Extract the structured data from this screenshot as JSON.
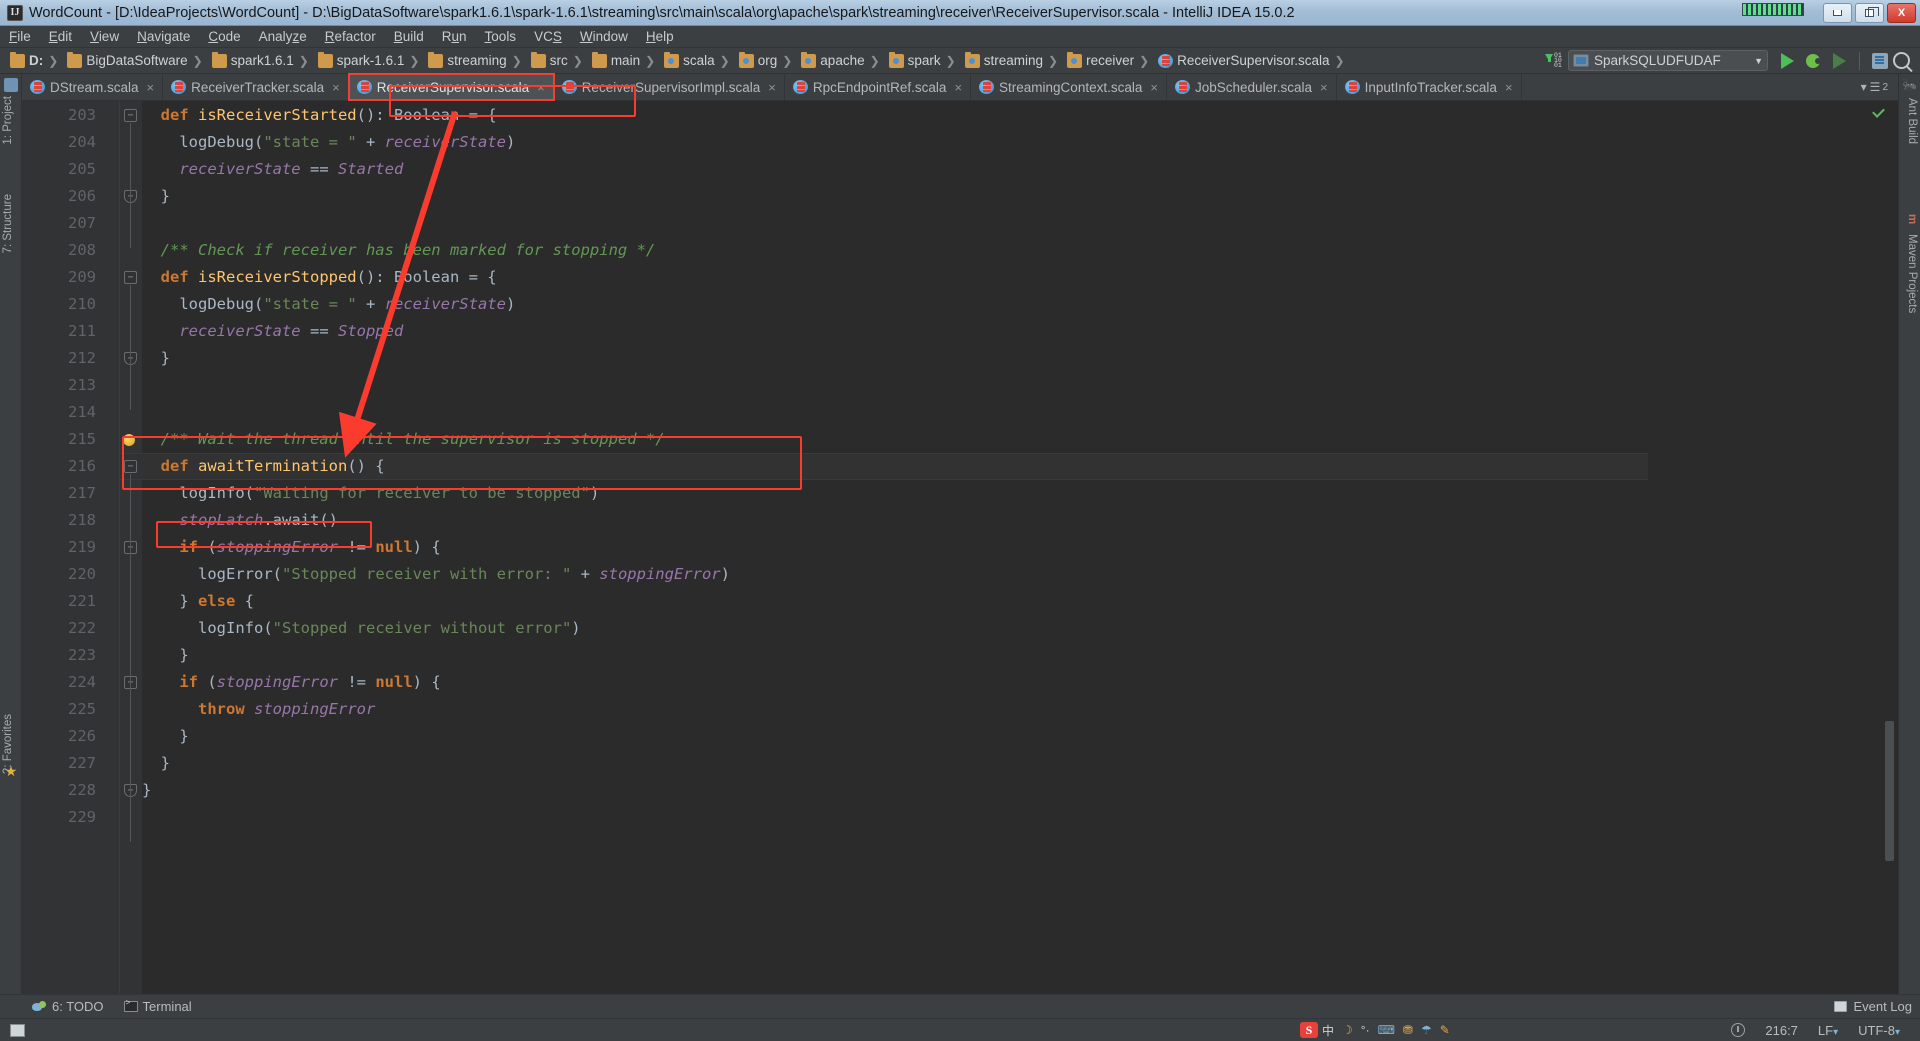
{
  "window": {
    "title": "WordCount - [D:\\IdeaProjects\\WordCount] - D:\\BigDataSoftware\\spark1.6.1\\spark-1.6.1\\streaming\\src\\main\\scala\\org\\apache\\spark\\streaming\\receiver\\ReceiverSupervisor.scala - IntelliJ IDEA 15.0.2",
    "app_icon": "intellij-idea-icon",
    "minimize_label": "",
    "restore_label": "",
    "close_label": "X"
  },
  "menu": {
    "items": [
      {
        "label": "File",
        "mnemonic": "F"
      },
      {
        "label": "Edit",
        "mnemonic": "E"
      },
      {
        "label": "View",
        "mnemonic": "V"
      },
      {
        "label": "Navigate",
        "mnemonic": "N"
      },
      {
        "label": "Code",
        "mnemonic": "C"
      },
      {
        "label": "Analyze",
        "mnemonic": "z"
      },
      {
        "label": "Refactor",
        "mnemonic": "R"
      },
      {
        "label": "Build",
        "mnemonic": "B"
      },
      {
        "label": "Run",
        "mnemonic": "u"
      },
      {
        "label": "Tools",
        "mnemonic": "T"
      },
      {
        "label": "VCS",
        "mnemonic": "S"
      },
      {
        "label": "Window",
        "mnemonic": "W"
      },
      {
        "label": "Help",
        "mnemonic": "H"
      }
    ]
  },
  "navbar": {
    "breadcrumbs": [
      {
        "label": "D:",
        "icon": "folder-icon",
        "bold": true
      },
      {
        "label": "BigDataSoftware",
        "icon": "folder-icon"
      },
      {
        "label": "spark1.6.1",
        "icon": "folder-icon"
      },
      {
        "label": "spark-1.6.1",
        "icon": "folder-icon"
      },
      {
        "label": "streaming",
        "icon": "folder-icon"
      },
      {
        "label": "src",
        "icon": "folder-icon"
      },
      {
        "label": "main",
        "icon": "folder-icon"
      },
      {
        "label": "scala",
        "icon": "source-folder-icon"
      },
      {
        "label": "org",
        "icon": "source-folder-icon"
      },
      {
        "label": "apache",
        "icon": "source-folder-icon"
      },
      {
        "label": "spark",
        "icon": "source-folder-icon"
      },
      {
        "label": "streaming",
        "icon": "source-folder-icon"
      },
      {
        "label": "receiver",
        "icon": "source-folder-icon"
      },
      {
        "label": "ReceiverSupervisor.scala",
        "icon": "scala-file-icon"
      }
    ],
    "separator": "❯",
    "download_icon": "download-updates-icon",
    "download_bits": [
      "01",
      "10",
      "01"
    ],
    "run_config": {
      "label": "SparkSQLUDFUDAF",
      "icon": "application-config-icon",
      "caret": "▼"
    },
    "buttons": [
      {
        "name": "run-button",
        "icon": "run-play-icon"
      },
      {
        "name": "debug-button",
        "icon": "debug-bug-icon"
      },
      {
        "name": "run-coverage-button",
        "icon": "run-coverage-icon"
      },
      {
        "name": "structure-button",
        "icon": "project-structure-icon"
      },
      {
        "name": "search-everywhere-button",
        "icon": "search-icon"
      }
    ]
  },
  "left_rail": {
    "items": [
      {
        "label": "1: Project",
        "icon": "project-tool-icon"
      },
      {
        "label": "7: Structure",
        "icon": "structure-tool-icon"
      },
      {
        "label": "2: Favorites",
        "icon": "favorites-tool-icon"
      }
    ],
    "star_icon": "star-icon"
  },
  "right_rail": {
    "items": [
      {
        "label": "Ant Build",
        "icon": "ant-icon"
      },
      {
        "label": "Maven Projects",
        "icon": "maven-icon"
      }
    ],
    "top_icon": "ant-build-icon",
    "maven_letter": "m"
  },
  "editor_tabs": {
    "tabs": [
      {
        "label": "DStream.scala",
        "icon": "scala-file-icon",
        "active": false,
        "close": "×"
      },
      {
        "label": "ReceiverTracker.scala",
        "icon": "scala-file-icon",
        "active": false,
        "close": "×"
      },
      {
        "label": "ReceiverSupervisor.scala",
        "icon": "scala-file-icon",
        "active": true,
        "highlighted": true,
        "close": "×"
      },
      {
        "label": "ReceiverSupervisorImpl.scala",
        "icon": "scala-file-icon",
        "active": false,
        "close": "×"
      },
      {
        "label": "RpcEndpointRef.scala",
        "icon": "scala-file-icon",
        "active": false,
        "close": "×"
      },
      {
        "label": "StreamingContext.scala",
        "icon": "scala-file-icon",
        "active": false,
        "close": "×"
      },
      {
        "label": "JobScheduler.scala",
        "icon": "scala-file-icon",
        "active": false,
        "close": "×"
      },
      {
        "label": "InputInfoTracker.scala",
        "icon": "scala-file-icon",
        "active": false,
        "close": "×"
      }
    ],
    "overflow": {
      "caret": "▾",
      "icon": "tab-list-icon",
      "count": "2"
    }
  },
  "editor": {
    "first_line": 203,
    "caret_line_index": 13,
    "gutter_bulb_line": 215,
    "annotations": {
      "box_color": "#fb3b2e",
      "boxes": [
        {
          "name": "annot-box-tab",
          "target": "ReceiverSupervisor.scala tab"
        },
        {
          "name": "annot-box-await-termination",
          "target": "lines 215-216 awaitTermination"
        },
        {
          "name": "annot-box-stoplatch-await",
          "target": "line 218 stopLatch.await()"
        }
      ],
      "arrow": {
        "name": "annot-arrow",
        "from": "ReceiverSupervisor.scala tab",
        "to": "awaitTermination definition"
      }
    },
    "lines": [
      {
        "n": "203",
        "fold": "minus",
        "tokens": [
          {
            "t": "  ",
            "c": "p"
          },
          {
            "t": "def ",
            "c": "k"
          },
          {
            "t": "isReceiverStarted",
            "c": "fn"
          },
          {
            "t": "(): Boolean = {",
            "c": "p"
          }
        ]
      },
      {
        "n": "204",
        "tokens": [
          {
            "t": "    ",
            "c": "p"
          },
          {
            "t": "logDebug",
            "c": "p"
          },
          {
            "t": "(",
            "c": "p"
          },
          {
            "t": "\"state = \"",
            "c": "s"
          },
          {
            "t": " + ",
            "c": "p"
          },
          {
            "t": "receiverState",
            "c": "f"
          },
          {
            "t": ")",
            "c": "p"
          }
        ]
      },
      {
        "n": "205",
        "tokens": [
          {
            "t": "    ",
            "c": "p"
          },
          {
            "t": "receiverState",
            "c": "f"
          },
          {
            "t": " == ",
            "c": "p"
          },
          {
            "t": "Started",
            "c": "t"
          }
        ]
      },
      {
        "n": "206",
        "fold": "end",
        "tokens": [
          {
            "t": "  }",
            "c": "p"
          }
        ]
      },
      {
        "n": "207",
        "tokens": []
      },
      {
        "n": "208",
        "tokens": [
          {
            "t": "  /** Check if receiver has been marked for stopping */",
            "c": "c"
          }
        ]
      },
      {
        "n": "209",
        "fold": "minus",
        "tokens": [
          {
            "t": "  ",
            "c": "p"
          },
          {
            "t": "def ",
            "c": "k"
          },
          {
            "t": "isReceiverStopped",
            "c": "fn"
          },
          {
            "t": "(): Boolean = {",
            "c": "p"
          }
        ]
      },
      {
        "n": "210",
        "tokens": [
          {
            "t": "    ",
            "c": "p"
          },
          {
            "t": "logDebug",
            "c": "p"
          },
          {
            "t": "(",
            "c": "p"
          },
          {
            "t": "\"state = \"",
            "c": "s"
          },
          {
            "t": " + ",
            "c": "p"
          },
          {
            "t": "receiverState",
            "c": "f"
          },
          {
            "t": ")",
            "c": "p"
          }
        ]
      },
      {
        "n": "211",
        "tokens": [
          {
            "t": "    ",
            "c": "p"
          },
          {
            "t": "receiverState",
            "c": "f"
          },
          {
            "t": " == ",
            "c": "p"
          },
          {
            "t": "Stopped",
            "c": "t"
          }
        ]
      },
      {
        "n": "212",
        "fold": "end",
        "tokens": [
          {
            "t": "  }",
            "c": "p"
          }
        ]
      },
      {
        "n": "213",
        "tokens": []
      },
      {
        "n": "214",
        "tokens": []
      },
      {
        "n": "215",
        "bulb": true,
        "tokens": [
          {
            "t": "  /** Wait the thread until the supervisor is stopped */",
            "c": "c"
          }
        ]
      },
      {
        "n": "216",
        "fold": "minus",
        "caret": true,
        "tokens": [
          {
            "t": "  ",
            "c": "p"
          },
          {
            "t": "def ",
            "c": "k"
          },
          {
            "t": "awaitTermination",
            "c": "fn"
          },
          {
            "t": "() {",
            "c": "p"
          }
        ]
      },
      {
        "n": "217",
        "tokens": [
          {
            "t": "    ",
            "c": "p"
          },
          {
            "t": "logInfo",
            "c": "p"
          },
          {
            "t": "(",
            "c": "p"
          },
          {
            "t": "\"Waiting for receiver to be stopped\"",
            "c": "s"
          },
          {
            "t": ")",
            "c": "p"
          }
        ]
      },
      {
        "n": "218",
        "tokens": [
          {
            "t": "    ",
            "c": "p"
          },
          {
            "t": "stopLatch",
            "c": "f"
          },
          {
            "t": ".await()",
            "c": "p"
          }
        ]
      },
      {
        "n": "219",
        "fold": "minus",
        "tokens": [
          {
            "t": "    ",
            "c": "p"
          },
          {
            "t": "if ",
            "c": "k"
          },
          {
            "t": "(",
            "c": "p"
          },
          {
            "t": "stoppingError",
            "c": "f"
          },
          {
            "t": " != ",
            "c": "p"
          },
          {
            "t": "null",
            "c": "k"
          },
          {
            "t": ") {",
            "c": "p"
          }
        ]
      },
      {
        "n": "220",
        "tokens": [
          {
            "t": "      ",
            "c": "p"
          },
          {
            "t": "logError",
            "c": "p"
          },
          {
            "t": "(",
            "c": "p"
          },
          {
            "t": "\"Stopped receiver with error: \"",
            "c": "s"
          },
          {
            "t": " + ",
            "c": "p"
          },
          {
            "t": "stoppingError",
            "c": "f"
          },
          {
            "t": ")",
            "c": "p"
          }
        ]
      },
      {
        "n": "221",
        "tokens": [
          {
            "t": "    } ",
            "c": "p"
          },
          {
            "t": "else",
            "c": "k"
          },
          {
            "t": " {",
            "c": "p"
          }
        ]
      },
      {
        "n": "222",
        "tokens": [
          {
            "t": "      ",
            "c": "p"
          },
          {
            "t": "logInfo",
            "c": "p"
          },
          {
            "t": "(",
            "c": "p"
          },
          {
            "t": "\"Stopped receiver without error\"",
            "c": "s"
          },
          {
            "t": ")",
            "c": "p"
          }
        ]
      },
      {
        "n": "223",
        "tokens": [
          {
            "t": "    }",
            "c": "p"
          }
        ]
      },
      {
        "n": "224",
        "fold": "minus",
        "tokens": [
          {
            "t": "    ",
            "c": "p"
          },
          {
            "t": "if ",
            "c": "k"
          },
          {
            "t": "(",
            "c": "p"
          },
          {
            "t": "stoppingError",
            "c": "f"
          },
          {
            "t": " != ",
            "c": "p"
          },
          {
            "t": "null",
            "c": "k"
          },
          {
            "t": ") {",
            "c": "p"
          }
        ]
      },
      {
        "n": "225",
        "tokens": [
          {
            "t": "      ",
            "c": "p"
          },
          {
            "t": "throw ",
            "c": "k"
          },
          {
            "t": "stoppingError",
            "c": "f"
          }
        ]
      },
      {
        "n": "226",
        "tokens": [
          {
            "t": "    }",
            "c": "p"
          }
        ]
      },
      {
        "n": "227",
        "tokens": [
          {
            "t": "  }",
            "c": "p"
          }
        ]
      },
      {
        "n": "228",
        "fold": "end",
        "tokens": [
          {
            "t": "}",
            "c": "p"
          }
        ]
      },
      {
        "n": "229",
        "tokens": []
      }
    ],
    "inspection_status": "ok",
    "inspection_icon": "checkmark-icon"
  },
  "tool_window_bar": {
    "todo": {
      "label": "6: TODO",
      "mnemonic": "6",
      "icon": "todo-icon"
    },
    "terminal": {
      "label": "Terminal",
      "icon": "terminal-icon"
    },
    "event_log": {
      "label": "Event Log",
      "icon": "event-log-icon"
    }
  },
  "status_bar": {
    "caret_position": "216:7",
    "line_separator": "LF",
    "encoding": "UTF-8",
    "encoding_caret": "▾",
    "lock_icon": "read-only-lock-icon",
    "lf_caret": "↕"
  },
  "tray": {
    "ime_logo": "S",
    "items": [
      "中",
      "☽",
      "°·",
      "⌨",
      "⛃",
      "☂",
      "✎"
    ]
  },
  "colors": {
    "titlebar_accent": "#a3bdd6",
    "chrome": "#3c3f41",
    "editor_bg": "#2b2b2b",
    "gutter_bg": "#313335",
    "annotation_red": "#fb3b2e",
    "keyword_orange": "#cc7832",
    "string_green": "#6a8759",
    "comment_green": "#629755",
    "field_purple": "#9876aa",
    "method_yellow": "#ffc66d",
    "text_grey": "#a9b7c6",
    "run_green": "#4cbf57"
  }
}
